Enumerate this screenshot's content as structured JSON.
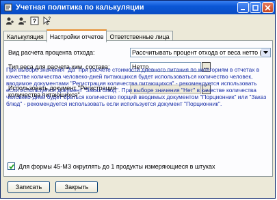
{
  "window": {
    "title": "Учетная политика по калькуляции"
  },
  "toolbar": {
    "icons": [
      "person-add-icon",
      "person-remove-icon",
      "help-icon",
      "pointer-help-icon"
    ]
  },
  "tabs": [
    {
      "label": "Калькуляция",
      "active": false
    },
    {
      "label": "Настройки отчетов",
      "active": true
    },
    {
      "label": "Ответственные лица",
      "active": false
    }
  ],
  "fields": {
    "waste_calc": {
      "label": "Вид расчета процента отхода:",
      "value": "Рассчитывать процент отхода от веса нетто (0)"
    },
    "weight_type": {
      "label": "Тип веса для расчета хим. состава:",
      "value": "Нетто"
    },
    "use_document": {
      "label": "Использовать документ \"Регистрация количества питающихся\"",
      "value": ""
    }
  },
  "info_text": "При выборе значения \"Да\" при расчете стоимости дневного питания  по категориям в отчетах в качестве количества человеко-дней питающихся будет использоваться количество человек, вводимое документами \"Регистрация количества питающихся\" - рекомендуется использовать если используется  документ  \"Заказ блюд\". При выборе значения \"Нет\" в качестве количества человеко-дней будет браться количество порций вводимых документом \"Порционник\" или \"Заказ блюд\" - рекомендуется использовать если используется документ \"Порционник\".",
  "checkbox": {
    "label": "Для формы 45-МЗ округлять до 1 продукты измеряющиеся в штуках",
    "checked": true
  },
  "buttons": {
    "save": "Записать",
    "close": "Закрыть"
  },
  "colors": {
    "title_bar": "#0b57d6",
    "info_text": "#1a2fa8",
    "active_tab_accent": "#e68b2c",
    "close_button": "#c4451f"
  }
}
